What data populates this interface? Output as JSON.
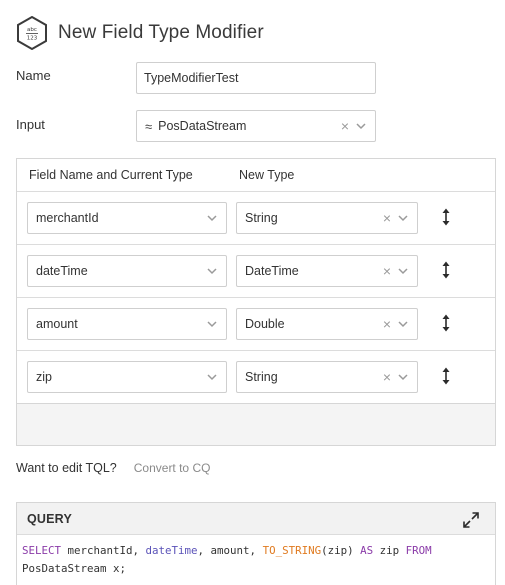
{
  "header": {
    "title": "New Field Type Modifier",
    "icon": "hexagon-abc-123-icon"
  },
  "form": {
    "name_label": "Name",
    "name_value": "TypeModifierTest",
    "input_label": "Input",
    "input_value": "PosDataStream",
    "input_icon": "≈"
  },
  "grid": {
    "col_name": "Field Name and Current Type",
    "col_type": "New Type",
    "rows": [
      {
        "field": "merchantId",
        "type": "String"
      },
      {
        "field": "dateTime",
        "type": "DateTime"
      },
      {
        "field": "amount",
        "type": "Double"
      },
      {
        "field": "zip",
        "type": "String"
      }
    ]
  },
  "tql": {
    "prompt": "Want to edit TQL?",
    "link": "Convert to CQ"
  },
  "query": {
    "label": "QUERY",
    "tokens": {
      "select": "SELECT",
      "merchant": " merchantId, ",
      "datetime": "dateTime",
      "amount": ", amount, ",
      "tostring": "TO_STRING",
      "zip_arg": "(zip) ",
      "as": "AS",
      "zip_alias": " zip ",
      "from": "FROM",
      "source": "PosDataStream x;"
    }
  },
  "colors": {
    "keyword": "#8a3aa8",
    "function": "#e07a1f",
    "column": "#5a52b8",
    "border": "#d6d6d6"
  }
}
